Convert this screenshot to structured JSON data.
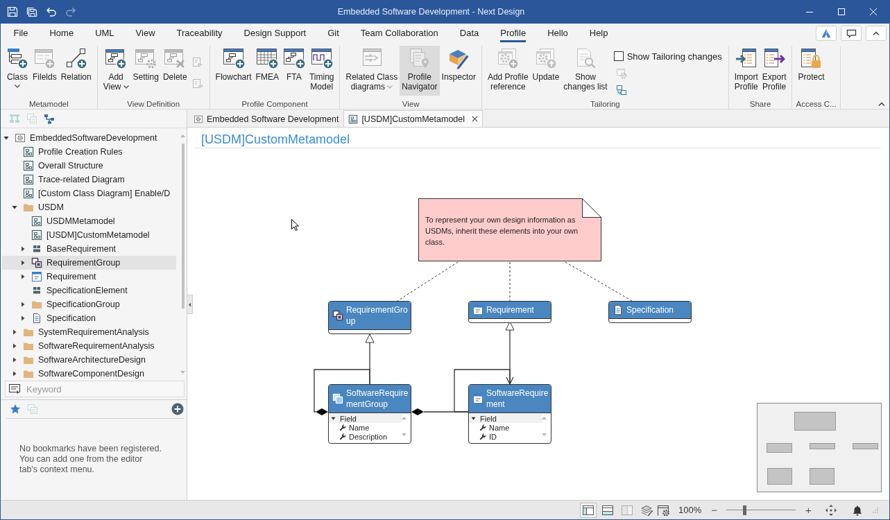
{
  "window": {
    "title": "Embedded Software Development - Next Design",
    "quick_access": [
      {
        "disabled": false
      },
      {
        "disabled": false
      },
      {
        "disabled": false
      },
      {
        "disabled": true
      }
    ]
  },
  "menu": {
    "tabs": [
      {
        "label": "File",
        "selected": false
      },
      {
        "label": "Home",
        "selected": false
      },
      {
        "label": "UML",
        "selected": false
      },
      {
        "label": "View",
        "selected": false
      },
      {
        "label": "Traceability",
        "selected": false
      },
      {
        "label": "Design Support",
        "selected": false
      },
      {
        "label": "Git",
        "selected": false
      },
      {
        "label": "Team Collaboration",
        "selected": false
      },
      {
        "label": "Data",
        "selected": false
      },
      {
        "label": "Profile",
        "selected": true
      },
      {
        "label": "Hello",
        "selected": false
      },
      {
        "label": "Help",
        "selected": false
      }
    ]
  },
  "ribbon": {
    "groups": [
      {
        "label": "Metamodel",
        "items": [
          {
            "kind": "large",
            "label": "Class",
            "dropdown": true,
            "disabled": false,
            "pressed": false
          },
          {
            "kind": "large",
            "label": "Filelds",
            "dropdown": false,
            "disabled": true,
            "pressed": false
          },
          {
            "kind": "large",
            "label": "Relation",
            "dropdown": false,
            "disabled": false,
            "pressed": false
          }
        ]
      },
      {
        "label": "View Definition",
        "items": [
          {
            "kind": "large",
            "label": "Add\nView",
            "dropdown": true,
            "disabled": false,
            "pressed": false
          },
          {
            "kind": "large",
            "label": "Setting",
            "dropdown": false,
            "disabled": true,
            "pressed": false
          },
          {
            "kind": "large",
            "label": "Delete",
            "dropdown": false,
            "disabled": true,
            "pressed": false
          },
          {
            "kind": "stack",
            "items": [
              {
                "kind": "small",
                "disabled": true
              },
              {
                "kind": "small",
                "disabled": true
              }
            ]
          }
        ]
      },
      {
        "label": "Profile Component",
        "items": [
          {
            "kind": "large",
            "label": "Flowchart",
            "dropdown": false,
            "disabled": false,
            "pressed": false
          },
          {
            "kind": "large",
            "label": "FMEA",
            "dropdown": false,
            "disabled": false,
            "pressed": false
          },
          {
            "kind": "large",
            "label": "FTA",
            "dropdown": false,
            "disabled": false,
            "pressed": false
          },
          {
            "kind": "large",
            "label": "Timing\nModel",
            "dropdown": false,
            "disabled": false,
            "pressed": false
          }
        ]
      },
      {
        "label": "View",
        "items": [
          {
            "kind": "large",
            "label": "Related Class\ndiagrams",
            "dropdown": true,
            "disabled": true,
            "pressed": false
          },
          {
            "kind": "large",
            "label": "Profile\nNavigator",
            "dropdown": false,
            "disabled": true,
            "pressed": true
          },
          {
            "kind": "large",
            "label": "Inspector",
            "dropdown": false,
            "disabled": false,
            "pressed": false
          }
        ]
      },
      {
        "label": "Tailoring",
        "items": [
          {
            "kind": "large",
            "label": "Add Profile\nreference",
            "dropdown": false,
            "disabled": true,
            "pressed": false
          },
          {
            "kind": "large",
            "label": "Update",
            "dropdown": false,
            "disabled": true,
            "pressed": false
          },
          {
            "kind": "large",
            "label": "Show\nchanges list",
            "dropdown": false,
            "disabled": true,
            "pressed": false
          },
          {
            "kind": "stack",
            "items": [
              {
                "kind": "checkbox",
                "label": "Show Tailoring changes",
                "checked": false
              },
              {
                "kind": "small",
                "disabled": true
              },
              {
                "kind": "small",
                "disabled": false
              }
            ]
          }
        ]
      },
      {
        "label": "Share",
        "items": [
          {
            "kind": "large",
            "label": "Import\nProfile",
            "dropdown": false,
            "disabled": false,
            "pressed": false
          },
          {
            "kind": "large",
            "label": "Export\nProfile",
            "dropdown": false,
            "disabled": false,
            "pressed": false
          }
        ]
      },
      {
        "label": "Access C...",
        "items": [
          {
            "kind": "large",
            "label": "Protect",
            "dropdown": false,
            "disabled": false,
            "pressed": false
          }
        ]
      }
    ]
  },
  "navigator": {
    "toolbar": [
      {
        "disabled": true
      },
      {
        "disabled": true
      },
      {
        "disabled": false
      }
    ],
    "tree": [
      {
        "label": "EmbeddedSoftwareDevelopment",
        "kind": "model",
        "expanded": true,
        "selected": false,
        "children": [
          {
            "label": "Profile Creation Rules",
            "kind": "diagram",
            "selected": false
          },
          {
            "label": "Overall Structure",
            "kind": "diagram",
            "selected": false
          },
          {
            "label": "Trace-related Diagram",
            "kind": "diagram",
            "selected": false
          },
          {
            "label": "[Custom Class Diagram] Enable/D",
            "kind": "diagram",
            "selected": false
          },
          {
            "label": "USDM",
            "kind": "folder",
            "expanded": true,
            "selected": false,
            "children": [
              {
                "label": "USDMMetamodel",
                "kind": "diagram",
                "selected": false
              },
              {
                "label": "[USDM]CustomMetamodel",
                "kind": "diagram",
                "selected": false
              },
              {
                "label": "BaseRequirement",
                "kind": "block",
                "expanded": false,
                "selected": false
              },
              {
                "label": "RequirementGroup",
                "kind": "group",
                "expanded": false,
                "selected": true
              },
              {
                "label": "Requirement",
                "kind": "requirement",
                "expanded": false,
                "selected": false
              },
              {
                "label": "SpecificationElement",
                "kind": "block",
                "selected": false
              },
              {
                "label": "SpecificationGroup",
                "kind": "folder",
                "expanded": false,
                "selected": false
              },
              {
                "label": "Specification",
                "kind": "document",
                "expanded": false,
                "selected": false
              }
            ]
          },
          {
            "label": "SystemRequirementAnalysis",
            "kind": "folder",
            "expanded": false,
            "selected": false
          },
          {
            "label": "SoftwareRequirementAnalysis",
            "kind": "folder",
            "expanded": false,
            "selected": false
          },
          {
            "label": "SoftwareArchitectureDesign",
            "kind": "folder",
            "expanded": false,
            "selected": false
          },
          {
            "label": "SoftwareComponentDesign",
            "kind": "folder",
            "expanded": false,
            "selected": false
          }
        ]
      }
    ],
    "search": {
      "placeholder": "Keyword"
    }
  },
  "bookmarks": {
    "toolbar": [
      {
        "disabled": false
      },
      {
        "disabled": true
      },
      {
        "disabled": false
      }
    ],
    "message": "No bookmarks have been registered. You can add one from the editor tab's context menu."
  },
  "editor": {
    "tabs": [
      {
        "label": "Embedded Software Development",
        "selected": false,
        "closable": false
      },
      {
        "label": "[USDM]CustomMetamodel",
        "selected": true,
        "closable": true
      }
    ],
    "title": "[USDM]CustomMetamodel",
    "note": {
      "text": "To represent your own design information as USDMs, inherit these elements into your own class."
    },
    "classes": [
      {
        "name": "RequirementGroup"
      },
      {
        "name": "Requirement"
      },
      {
        "name": "Specification"
      },
      {
        "name": "SoftwareRequirementGroup",
        "section": {
          "label": "Field",
          "expanded": true,
          "items": [
            "Name",
            "Description"
          ]
        }
      },
      {
        "name": "SoftwareRequirement",
        "section": {
          "label": "Field",
          "expanded": true,
          "items": [
            "Name",
            "ID"
          ]
        }
      }
    ],
    "connectors": [
      {
        "kind": "anchor"
      },
      {
        "kind": "anchor"
      },
      {
        "kind": "anchor"
      },
      {
        "kind": "generalization"
      },
      {
        "kind": "generalization"
      },
      {
        "kind": "composition"
      },
      {
        "kind": "composition"
      },
      {
        "kind": "association"
      }
    ]
  },
  "status_bar": {
    "layout_buttons": [
      {
        "kind": "left-pane",
        "selected": true,
        "disabled": false
      },
      {
        "kind": "bottom-pane",
        "selected": false,
        "disabled": false
      },
      {
        "kind": "split-pane",
        "selected": false,
        "disabled": true
      }
    ],
    "zoom": {
      "value": "100%",
      "zoom_out": "−",
      "zoom_in": "+",
      "level": 0.26
    }
  }
}
